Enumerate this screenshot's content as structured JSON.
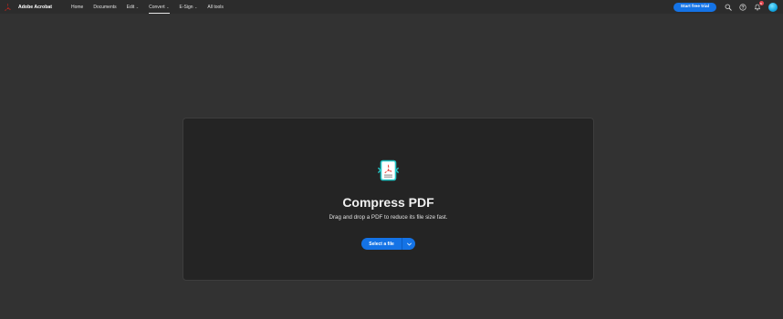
{
  "app": {
    "brand_name": "Adobe Acrobat",
    "logo_icon": "acrobat-logo-icon",
    "brand_color": "#e1251b"
  },
  "nav": {
    "items": [
      {
        "label": "Home",
        "has_menu": false,
        "active": false
      },
      {
        "label": "Documents",
        "has_menu": false,
        "active": false
      },
      {
        "label": "Edit",
        "has_menu": true,
        "active": false
      },
      {
        "label": "Convert",
        "has_menu": true,
        "active": true
      },
      {
        "label": "E-Sign",
        "has_menu": true,
        "active": false
      },
      {
        "label": "All tools",
        "has_menu": false,
        "active": false
      }
    ],
    "chevron_glyph": "⌄"
  },
  "header_actions": {
    "trial_label": "Start free trial",
    "search_icon": "search-icon",
    "help_icon": "help-icon",
    "bell_icon": "bell-icon",
    "notification_count": "5",
    "accent_color": "#1473e6"
  },
  "dropzone": {
    "tool_icon": "compress-pdf-icon",
    "title": "Compress PDF",
    "subtitle": "Drag and drop a PDF to reduce its file size fast.",
    "select_label": "Select a file",
    "dropdown_icon": "chevron-down-icon"
  }
}
